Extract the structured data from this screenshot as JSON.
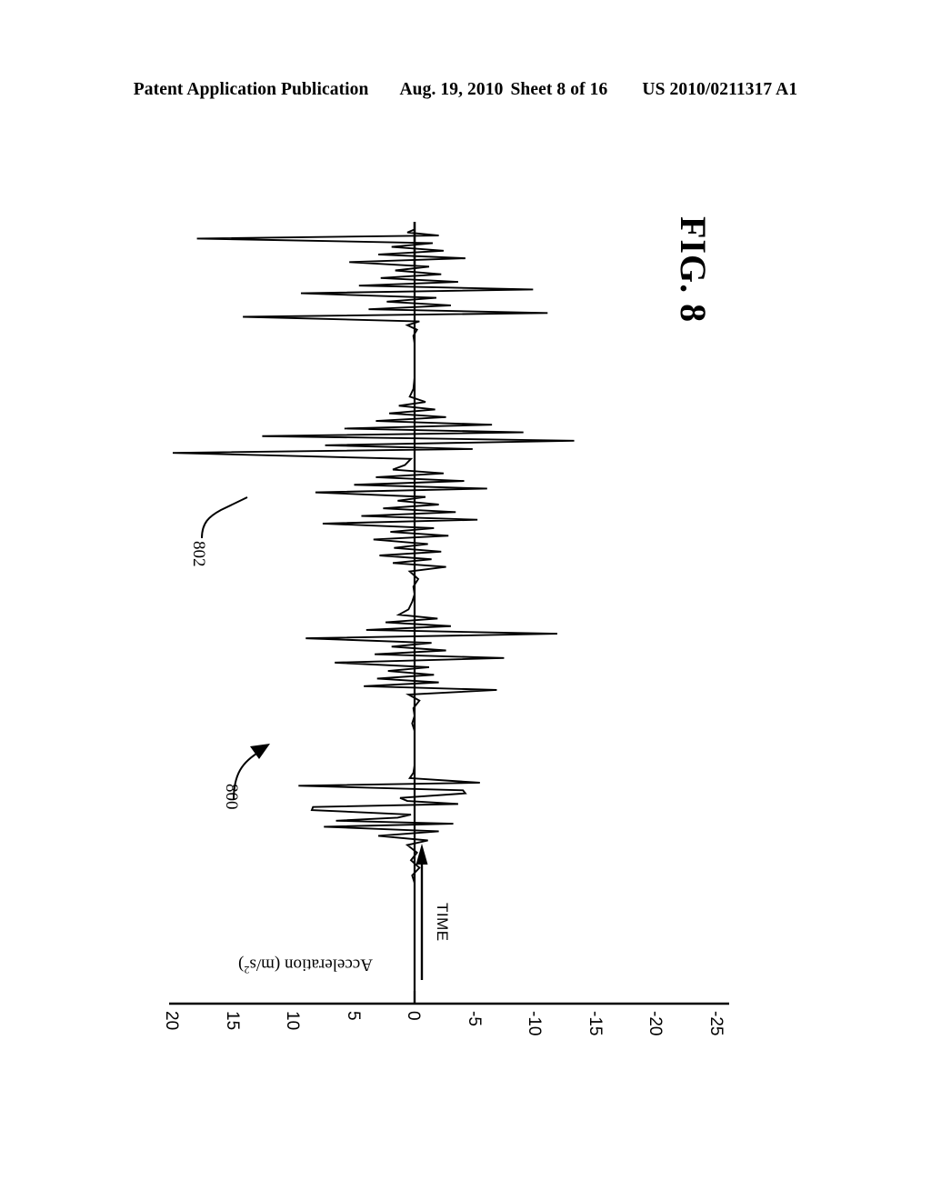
{
  "header": {
    "publication": "Patent Application Publication",
    "date": "Aug. 19, 2010",
    "sheet": "Sheet 8 of 16",
    "patent_number": "US 2010/0211317 A1"
  },
  "figure": {
    "label": "FIG. 8",
    "reference_numerals": [
      {
        "id": "800",
        "text": "800",
        "describes": "acceleration-waveform-plot"
      },
      {
        "id": "802",
        "text": "802",
        "describes": "largest-acceleration-spike"
      }
    ],
    "time_axis_label": "TIME"
  },
  "chart_data": {
    "type": "line",
    "title": "FIG. 8",
    "orientation": "vertical-time-axis",
    "xlabel": "Acceleration (m/s²)",
    "xlabel_plain": "Acceleration (m/s2)",
    "ylabel": "TIME",
    "grid": false,
    "legend": null,
    "axis_direction_note": "Acceleration axis increases to the left; time increases upward",
    "xticks": [
      20,
      15,
      10,
      5,
      0,
      -5,
      -10,
      -15,
      -20,
      -25
    ],
    "xtick_labels": [
      "20",
      "15",
      "10",
      "5",
      "0",
      "-5",
      "-10",
      "-15",
      "-20",
      "-25"
    ],
    "xlim": [
      20,
      -25
    ],
    "ylim": [
      0,
      100
    ],
    "series": [
      {
        "name": "Acceleration signal 800",
        "description": "Seismogram-style acceleration trace; time runs bottom to top, amplitude deflects left (positive) and right (negative).",
        "points": [
          [
            0.0,
            0.0
          ],
          [
            0.0,
            1.0
          ],
          [
            0.0,
            2.0
          ],
          [
            0.0,
            3.0
          ],
          [
            0.0,
            4.0
          ],
          [
            0.0,
            5.0
          ],
          [
            0.0,
            6.0
          ],
          [
            0.0,
            7.0
          ],
          [
            0.0,
            8.0
          ],
          [
            0.0,
            9.0
          ],
          [
            0.0,
            10.0
          ],
          [
            0.0,
            11.0
          ],
          [
            0.0,
            12.0
          ],
          [
            0.0,
            13.0
          ],
          [
            0.2,
            14.0
          ],
          [
            -0.4,
            15.0
          ],
          [
            0.3,
            16.0
          ],
          [
            -0.2,
            17.0
          ],
          [
            0.6,
            18.0
          ],
          [
            -1.1,
            18.6
          ],
          [
            3.0,
            19.2
          ],
          [
            -2.0,
            19.8
          ],
          [
            7.5,
            20.4
          ],
          [
            -3.2,
            20.8
          ],
          [
            6.5,
            21.2
          ],
          [
            1.4,
            21.6
          ],
          [
            0.3,
            22.0
          ],
          [
            8.5,
            22.6
          ],
          [
            8.4,
            23.0
          ],
          [
            -3.6,
            23.4
          ],
          [
            0.6,
            23.8
          ],
          [
            1.2,
            24.2
          ],
          [
            -4.2,
            24.8
          ],
          [
            -4.0,
            25.2
          ],
          [
            9.6,
            25.8
          ],
          [
            -5.4,
            26.2
          ],
          [
            0.4,
            26.8
          ],
          [
            0.1,
            27.5
          ],
          [
            0.0,
            28.5
          ],
          [
            0.0,
            30.0
          ],
          [
            0.0,
            31.5
          ],
          [
            0.0,
            33.0
          ],
          [
            0.2,
            34.0
          ],
          [
            0.0,
            35.0
          ],
          [
            0.1,
            36.0
          ],
          [
            -0.4,
            37.0
          ],
          [
            0.5,
            37.8
          ],
          [
            -6.8,
            38.4
          ],
          [
            4.2,
            38.9
          ],
          [
            -2.0,
            39.4
          ],
          [
            3.1,
            39.9
          ],
          [
            -1.6,
            40.4
          ],
          [
            2.2,
            40.9
          ],
          [
            -1.2,
            41.4
          ],
          [
            6.6,
            42.0
          ],
          [
            -7.4,
            42.6
          ],
          [
            3.3,
            43.1
          ],
          [
            -2.6,
            43.6
          ],
          [
            1.9,
            44.1
          ],
          [
            -1.4,
            44.6
          ],
          [
            9.0,
            45.2
          ],
          [
            -11.8,
            45.8
          ],
          [
            4.0,
            46.3
          ],
          [
            -3.0,
            46.8
          ],
          [
            2.4,
            47.3
          ],
          [
            -1.9,
            47.8
          ],
          [
            1.3,
            48.3
          ],
          [
            0.5,
            49.0
          ],
          [
            0.2,
            50.0
          ],
          [
            0.0,
            51.0
          ],
          [
            0.1,
            52.0
          ],
          [
            -0.3,
            53.0
          ],
          [
            0.4,
            54.0
          ],
          [
            -2.6,
            54.6
          ],
          [
            1.8,
            55.1
          ],
          [
            -1.4,
            55.6
          ],
          [
            2.9,
            56.1
          ],
          [
            -2.2,
            56.6
          ],
          [
            1.7,
            57.1
          ],
          [
            -1.1,
            57.6
          ],
          [
            3.4,
            58.2
          ],
          [
            -2.8,
            58.7
          ],
          [
            2.0,
            59.2
          ],
          [
            -1.6,
            59.7
          ],
          [
            7.6,
            60.3
          ],
          [
            -5.2,
            60.8
          ],
          [
            4.4,
            61.3
          ],
          [
            -3.4,
            61.8
          ],
          [
            2.6,
            62.3
          ],
          [
            -2.0,
            62.8
          ],
          [
            1.4,
            63.3
          ],
          [
            -0.9,
            63.8
          ],
          [
            8.2,
            64.4
          ],
          [
            -6.0,
            64.9
          ],
          [
            5.0,
            65.4
          ],
          [
            -4.1,
            65.9
          ],
          [
            3.2,
            66.4
          ],
          [
            -2.4,
            66.9
          ],
          [
            1.8,
            67.4
          ],
          [
            0.8,
            68.0
          ],
          [
            0.3,
            68.8
          ],
          [
            20.0,
            69.6
          ],
          [
            -4.8,
            70.1
          ],
          [
            7.4,
            70.6
          ],
          [
            -13.2,
            71.2
          ],
          [
            12.6,
            71.8
          ],
          [
            -9.0,
            72.3
          ],
          [
            5.8,
            72.8
          ],
          [
            -6.4,
            73.3
          ],
          [
            3.2,
            73.8
          ],
          [
            -2.6,
            74.3
          ],
          [
            2.1,
            74.8
          ],
          [
            -1.7,
            75.3
          ],
          [
            1.3,
            75.8
          ],
          [
            -0.9,
            76.3
          ],
          [
            0.4,
            77.0
          ],
          [
            0.1,
            78.0
          ],
          [
            0.0,
            79.5
          ],
          [
            0.0,
            81.0
          ],
          [
            0.0,
            82.5
          ],
          [
            0.0,
            84.0
          ],
          [
            0.1,
            85.0
          ],
          [
            -0.2,
            85.8
          ],
          [
            0.6,
            86.4
          ],
          [
            -0.4,
            86.9
          ],
          [
            14.2,
            87.5
          ],
          [
            -11.0,
            88.0
          ],
          [
            3.8,
            88.5
          ],
          [
            -3.0,
            89.0
          ],
          [
            2.3,
            89.5
          ],
          [
            -1.8,
            90.0
          ],
          [
            9.4,
            90.6
          ],
          [
            -9.8,
            91.1
          ],
          [
            4.6,
            91.6
          ],
          [
            -3.6,
            92.1
          ],
          [
            2.8,
            92.6
          ],
          [
            -2.2,
            93.1
          ],
          [
            1.6,
            93.6
          ],
          [
            -1.2,
            94.1
          ],
          [
            5.4,
            94.7
          ],
          [
            -4.2,
            95.2
          ],
          [
            3.0,
            95.7
          ],
          [
            -2.4,
            96.2
          ],
          [
            1.9,
            96.7
          ],
          [
            -1.5,
            97.2
          ],
          [
            18.0,
            97.8
          ],
          [
            -2.0,
            98.2
          ],
          [
            0.6,
            98.6
          ],
          [
            0.0,
            99.0
          ],
          [
            0.0,
            99.5
          ],
          [
            0.0,
            100.0
          ]
        ]
      }
    ]
  }
}
